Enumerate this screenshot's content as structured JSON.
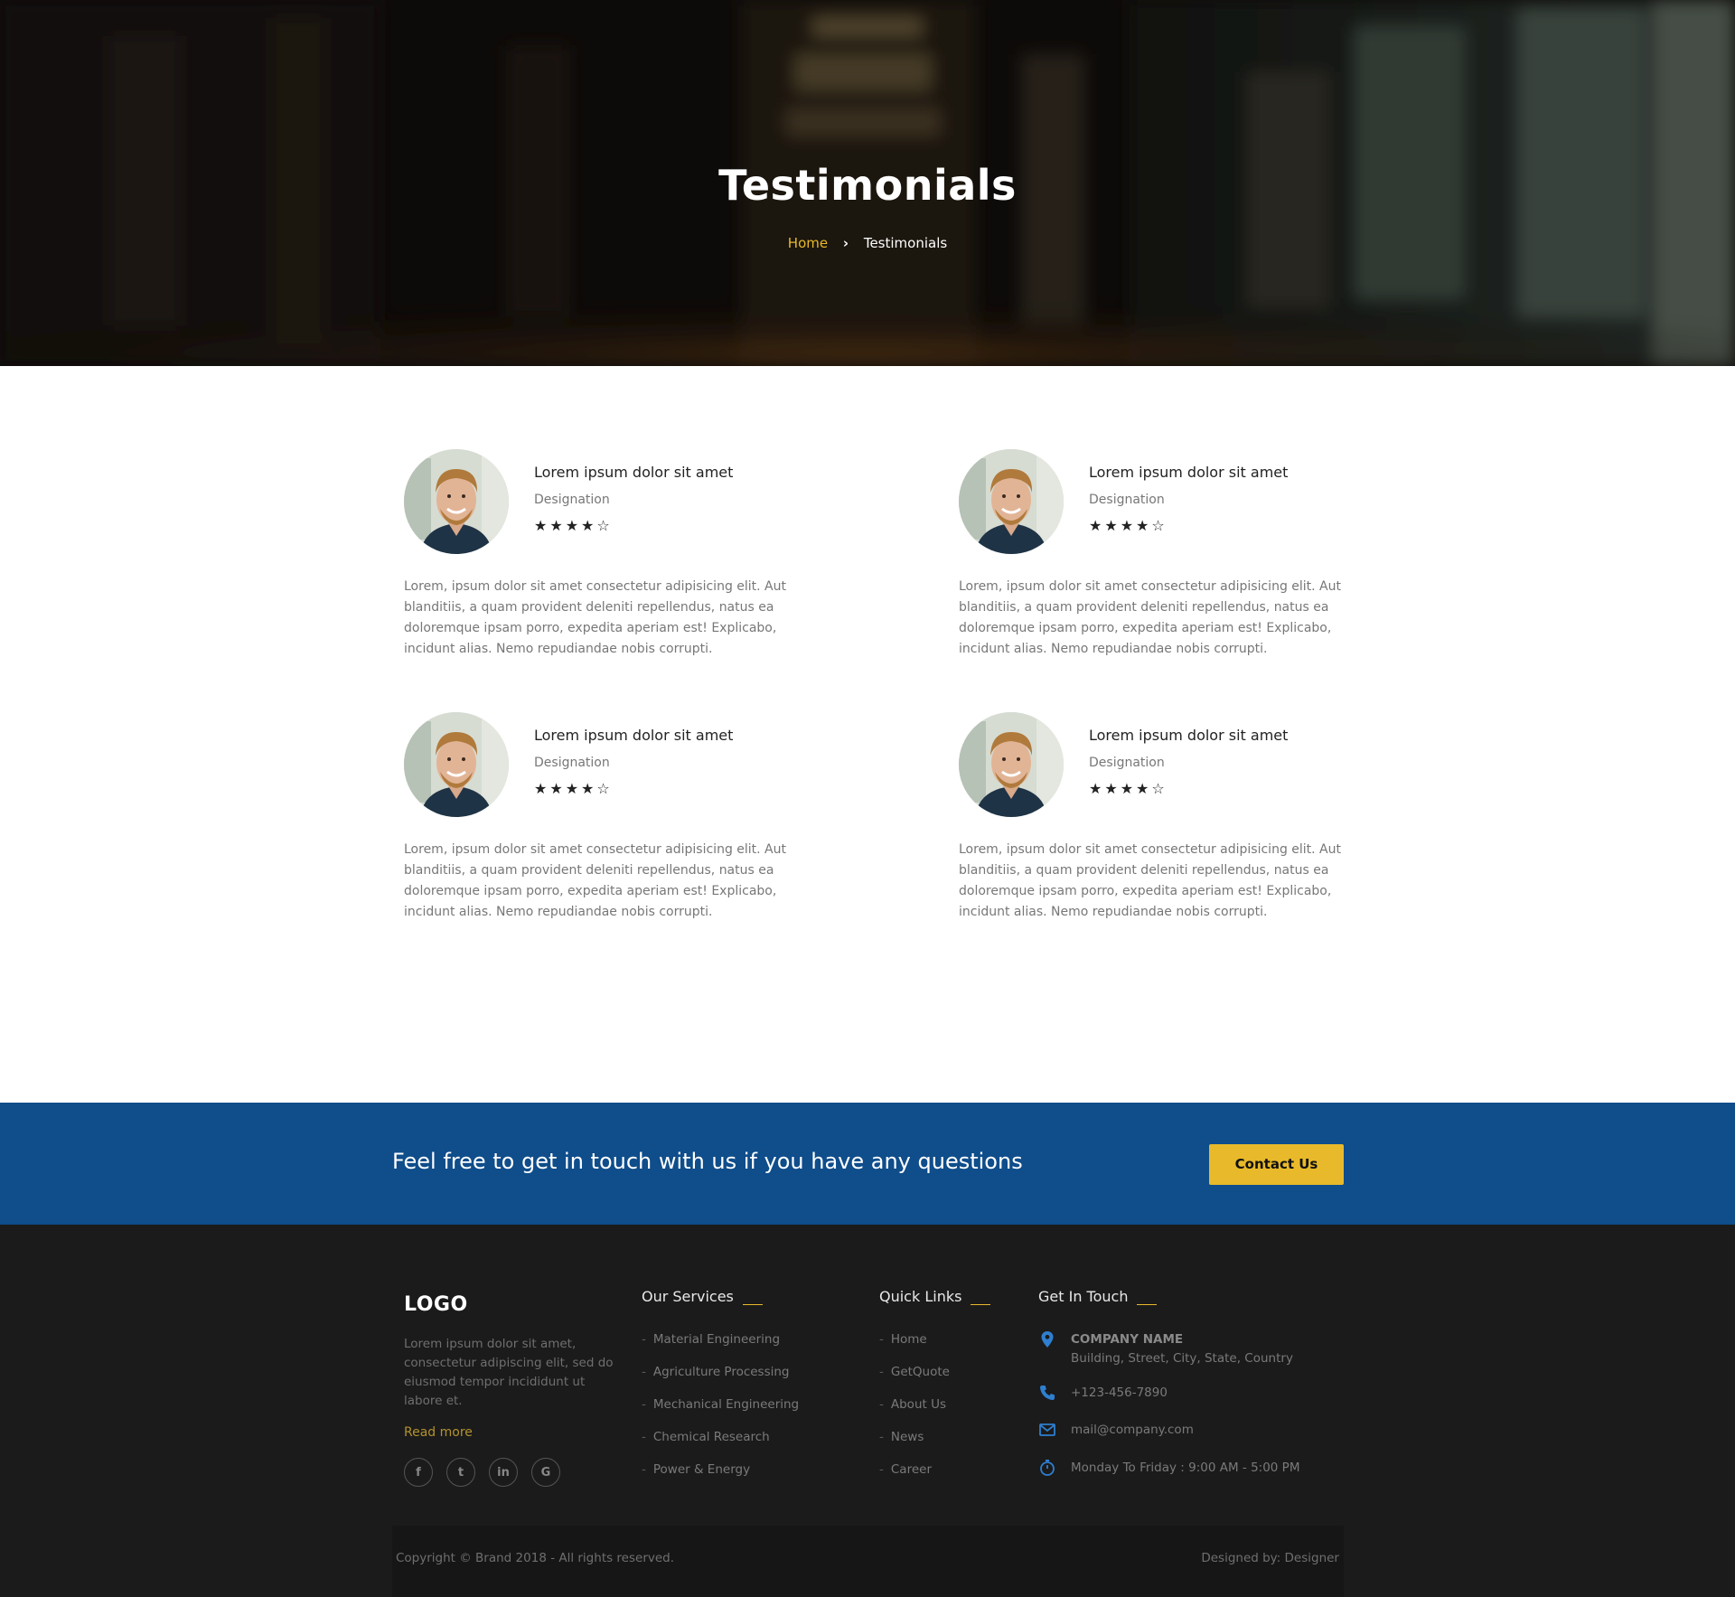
{
  "hero": {
    "title": "Testimonials",
    "breadcrumb": {
      "home": "Home",
      "separator": "›",
      "current": "Testimonials"
    }
  },
  "testimonials": [
    {
      "name": "Lorem ipsum dolor sit amet",
      "designation": "Designation",
      "rating": 4,
      "rating_max": 5,
      "stars": "★★★★☆",
      "text": "Lorem, ipsum dolor sit amet consectetur adipisicing elit. Aut blanditiis, a quam provident deleniti repellendus, natus ea doloremque ipsam porro, expedita aperiam est! Explicabo, incidunt alias. Nemo repudiandae nobis corrupti."
    },
    {
      "name": "Lorem ipsum dolor sit amet",
      "designation": "Designation",
      "rating": 4,
      "rating_max": 5,
      "stars": "★★★★☆",
      "text": "Lorem, ipsum dolor sit amet consectetur adipisicing elit. Aut blanditiis, a quam provident deleniti repellendus, natus ea doloremque ipsam porro, expedita aperiam est! Explicabo, incidunt alias. Nemo repudiandae nobis corrupti."
    },
    {
      "name": "Lorem ipsum dolor sit amet",
      "designation": "Designation",
      "rating": 4,
      "rating_max": 5,
      "stars": "★★★★☆",
      "text": "Lorem, ipsum dolor sit amet consectetur adipisicing elit. Aut blanditiis, a quam provident deleniti repellendus, natus ea doloremque ipsam porro, expedita aperiam est! Explicabo, incidunt alias. Nemo repudiandae nobis corrupti."
    },
    {
      "name": "Lorem ipsum dolor sit amet",
      "designation": "Designation",
      "rating": 4,
      "rating_max": 5,
      "stars": "★★★★☆",
      "text": "Lorem, ipsum dolor sit amet consectetur adipisicing elit. Aut blanditiis, a quam provident deleniti repellendus, natus ea doloremque ipsam porro, expedita aperiam est! Explicabo, incidunt alias. Nemo repudiandae nobis corrupti."
    }
  ],
  "cta": {
    "text": "Feel free to get in touch with us if you have any questions",
    "button": "Contact Us"
  },
  "footer": {
    "logo": "LOGO",
    "about": "Lorem ipsum dolor sit amet, consectetur adipiscing elit, sed do eiusmod tempor incididunt ut labore et.",
    "read_more": "Read more",
    "social": [
      {
        "icon": "facebook-icon",
        "glyph": "f"
      },
      {
        "icon": "twitter-icon",
        "glyph": "t"
      },
      {
        "icon": "linkedin-icon",
        "glyph": "in"
      },
      {
        "icon": "google-icon",
        "glyph": "G"
      }
    ],
    "services": {
      "heading": "Our Services",
      "items": [
        "Material Engineering",
        "Agriculture Processing",
        "Mechanical Engineering",
        "Chemical Research",
        "Power & Energy"
      ]
    },
    "quick_links": {
      "heading": "Quick Links",
      "items": [
        "Home",
        "GetQuote",
        "About Us",
        "News",
        "Career"
      ]
    },
    "get_in_touch": {
      "heading": "Get In Touch",
      "company_name": "COMPANY NAME",
      "address": "Building, Street, City, State, Country",
      "phone": "+123-456-7890",
      "email": "mail@company.com",
      "hours": "Monday To Friday : 9:00 AM - 5:00 PM"
    },
    "copyright": "Copyright © Brand 2018 - All rights reserved.",
    "designed_by": "Designed by: Designer"
  },
  "colors": {
    "accent": "#e8b92a",
    "cta_bg": "#0f4d8b",
    "footer_bg": "#1b1b1b",
    "icon_blue": "#2f7fd0"
  }
}
